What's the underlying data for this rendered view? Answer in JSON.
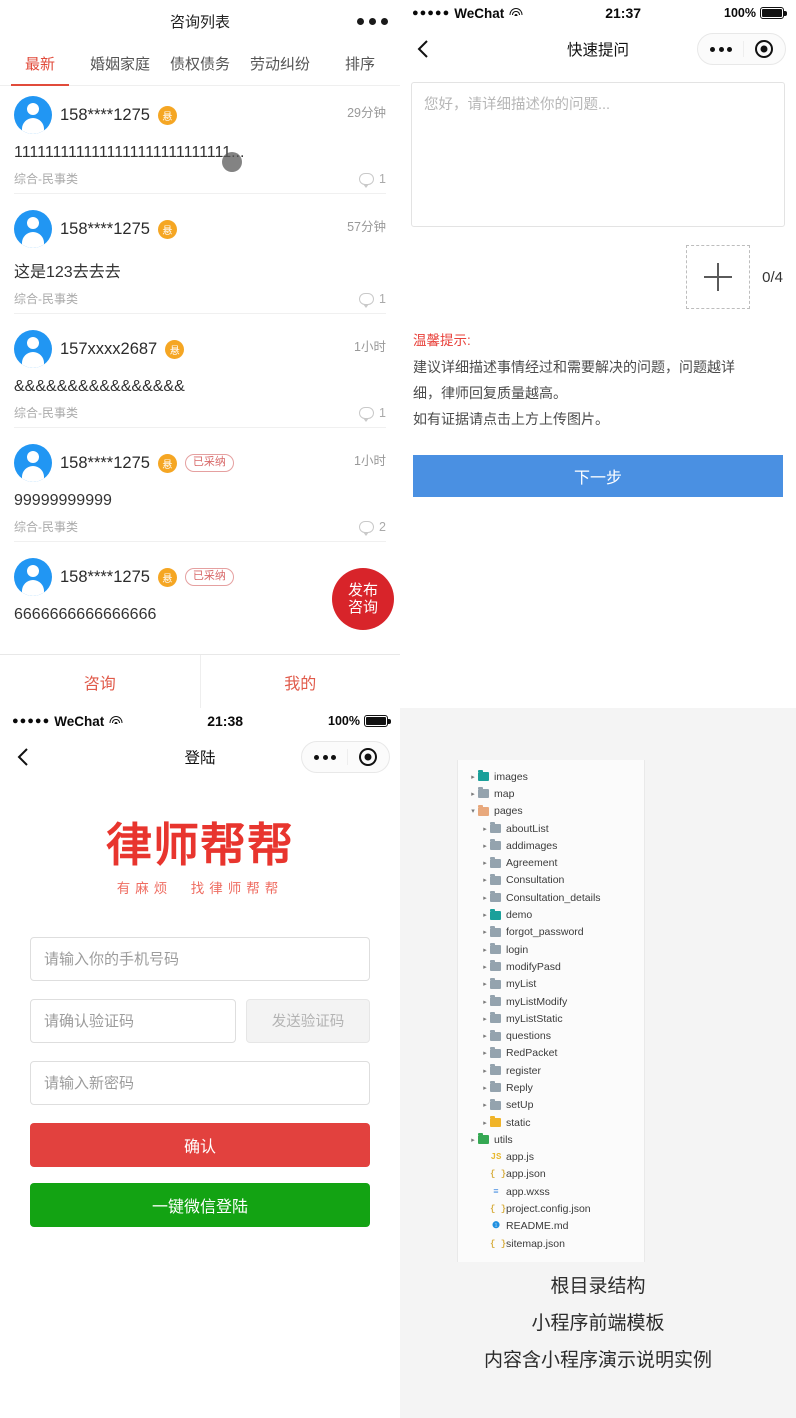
{
  "consultation_list": {
    "header_title": "咨询列表",
    "tabs": [
      {
        "label": "最新",
        "active": true
      },
      {
        "label": "婚姻家庭",
        "active": false
      },
      {
        "label": "债权债务",
        "active": false
      },
      {
        "label": "劳动纠纷",
        "active": false
      },
      {
        "label": "排序",
        "active": false
      }
    ],
    "items": [
      {
        "phone": "158****1275",
        "coin": "悬",
        "adopted": "",
        "time": "29分钟",
        "content": "1111111111111111111111111111...",
        "category": "综合-民事类",
        "comments": "1"
      },
      {
        "phone": "158****1275",
        "coin": "悬",
        "adopted": "",
        "time": "57分钟",
        "content": "这是123去去去",
        "category": "综合-民事类",
        "comments": "1"
      },
      {
        "phone": "157xxxx2687",
        "coin": "悬",
        "adopted": "",
        "time": "1小时",
        "content": "&&&&&&&&&&&&&&&&",
        "category": "综合-民事类",
        "comments": "1"
      },
      {
        "phone": "158****1275",
        "coin": "悬",
        "adopted": "已采纳",
        "time": "1小时",
        "content": "99999999999",
        "category": "综合-民事类",
        "comments": "2"
      },
      {
        "phone": "158****1275",
        "coin": "悬",
        "adopted": "已采纳",
        "time": "",
        "content": "6666666666666666",
        "category": "",
        "comments": ""
      }
    ],
    "fab_line1": "发布",
    "fab_line2": "咨询",
    "tabbar": [
      {
        "label": "咨询"
      },
      {
        "label": "我的"
      }
    ]
  },
  "quick_question": {
    "status": {
      "carrier": "WeChat",
      "dots": "●●●●●",
      "time": "21:37",
      "battery": "100%"
    },
    "nav_title": "快速提问",
    "back_icon": "‹",
    "textarea_placeholder": "您好，请详细描述你的问题...",
    "textarea_value": "",
    "upload_count": "0/4",
    "tip_title": "温馨提示:",
    "tip_lines": [
      "建议详细描述事情经过和需要解决的问题，问题越详",
      "细，律师回复质量越高。",
      "如有证据请点击上方上传图片。"
    ],
    "next_label": "下一步",
    "next_color": "#4a90e2"
  },
  "login": {
    "status": {
      "carrier": "WeChat",
      "dots": "●●●●●",
      "time": "21:38",
      "battery": "100%"
    },
    "nav_title": "登陆",
    "back_icon": "‹",
    "logo_main": "律师帮帮",
    "logo_sub": "有麻烦　找律师帮帮",
    "fields": [
      {
        "placeholder": "请输入你的手机号码",
        "value": ""
      },
      {
        "placeholder": "请确认验证码",
        "value": ""
      },
      {
        "placeholder": "请输入新密码",
        "value": ""
      }
    ],
    "send_code_label": "发送验证码",
    "confirm_label": "确认",
    "wechat_label": "一键微信登陆",
    "confirm_color": "#e2413e",
    "wechat_color": "#13a313"
  },
  "file_tree": {
    "nodes": [
      {
        "label": "images",
        "indent": 0,
        "type": "folder",
        "color": "teal",
        "arrow": "▸"
      },
      {
        "label": "map",
        "indent": 0,
        "type": "folder",
        "color": "gray",
        "arrow": "▸"
      },
      {
        "label": "pages",
        "indent": 0,
        "type": "folder",
        "color": "orange",
        "arrow": "▾"
      },
      {
        "label": "aboutList",
        "indent": 1,
        "type": "folder",
        "color": "gray",
        "arrow": "▸"
      },
      {
        "label": "addimages",
        "indent": 1,
        "type": "folder",
        "color": "gray",
        "arrow": "▸"
      },
      {
        "label": "Agreement",
        "indent": 1,
        "type": "folder",
        "color": "gray",
        "arrow": "▸"
      },
      {
        "label": "Consultation",
        "indent": 1,
        "type": "folder",
        "color": "gray",
        "arrow": "▸"
      },
      {
        "label": "Consultation_details",
        "indent": 1,
        "type": "folder",
        "color": "gray",
        "arrow": "▸"
      },
      {
        "label": "demo",
        "indent": 1,
        "type": "folder",
        "color": "teal",
        "arrow": "▸"
      },
      {
        "label": "forgot_password",
        "indent": 1,
        "type": "folder",
        "color": "gray",
        "arrow": "▸"
      },
      {
        "label": "login",
        "indent": 1,
        "type": "folder",
        "color": "gray",
        "arrow": "▸"
      },
      {
        "label": "modifyPasd",
        "indent": 1,
        "type": "folder",
        "color": "gray",
        "arrow": "▸"
      },
      {
        "label": "myList",
        "indent": 1,
        "type": "folder",
        "color": "gray",
        "arrow": "▸"
      },
      {
        "label": "myListModify",
        "indent": 1,
        "type": "folder",
        "color": "gray",
        "arrow": "▸"
      },
      {
        "label": "myListStatic",
        "indent": 1,
        "type": "folder",
        "color": "gray",
        "arrow": "▸"
      },
      {
        "label": "questions",
        "indent": 1,
        "type": "folder",
        "color": "gray",
        "arrow": "▸"
      },
      {
        "label": "RedPacket",
        "indent": 1,
        "type": "folder",
        "color": "gray",
        "arrow": "▸"
      },
      {
        "label": "register",
        "indent": 1,
        "type": "folder",
        "color": "gray",
        "arrow": "▸"
      },
      {
        "label": "Reply",
        "indent": 1,
        "type": "folder",
        "color": "gray",
        "arrow": "▸"
      },
      {
        "label": "setUp",
        "indent": 1,
        "type": "folder",
        "color": "gray",
        "arrow": "▸"
      },
      {
        "label": "static",
        "indent": 1,
        "type": "folder",
        "color": "yellow",
        "arrow": "▸"
      },
      {
        "label": "utils",
        "indent": 0,
        "type": "folder",
        "color": "green",
        "arrow": "▸"
      },
      {
        "label": "app.js",
        "indent": 1,
        "type": "js",
        "glyph": "JS",
        "arrow": ""
      },
      {
        "label": "app.json",
        "indent": 1,
        "type": "json",
        "glyph": "{ }",
        "arrow": ""
      },
      {
        "label": "app.wxss",
        "indent": 1,
        "type": "wxss",
        "glyph": "≡",
        "arrow": ""
      },
      {
        "label": "project.config.json",
        "indent": 1,
        "type": "json",
        "glyph": "{ }",
        "arrow": ""
      },
      {
        "label": "README.md",
        "indent": 1,
        "type": "md",
        "glyph": "❶",
        "arrow": ""
      },
      {
        "label": "sitemap.json",
        "indent": 1,
        "type": "json",
        "glyph": "{ }",
        "arrow": ""
      }
    ],
    "captions": [
      "根目录结构",
      "小程序前端模板",
      "内容含小程序演示说明实例"
    ]
  }
}
